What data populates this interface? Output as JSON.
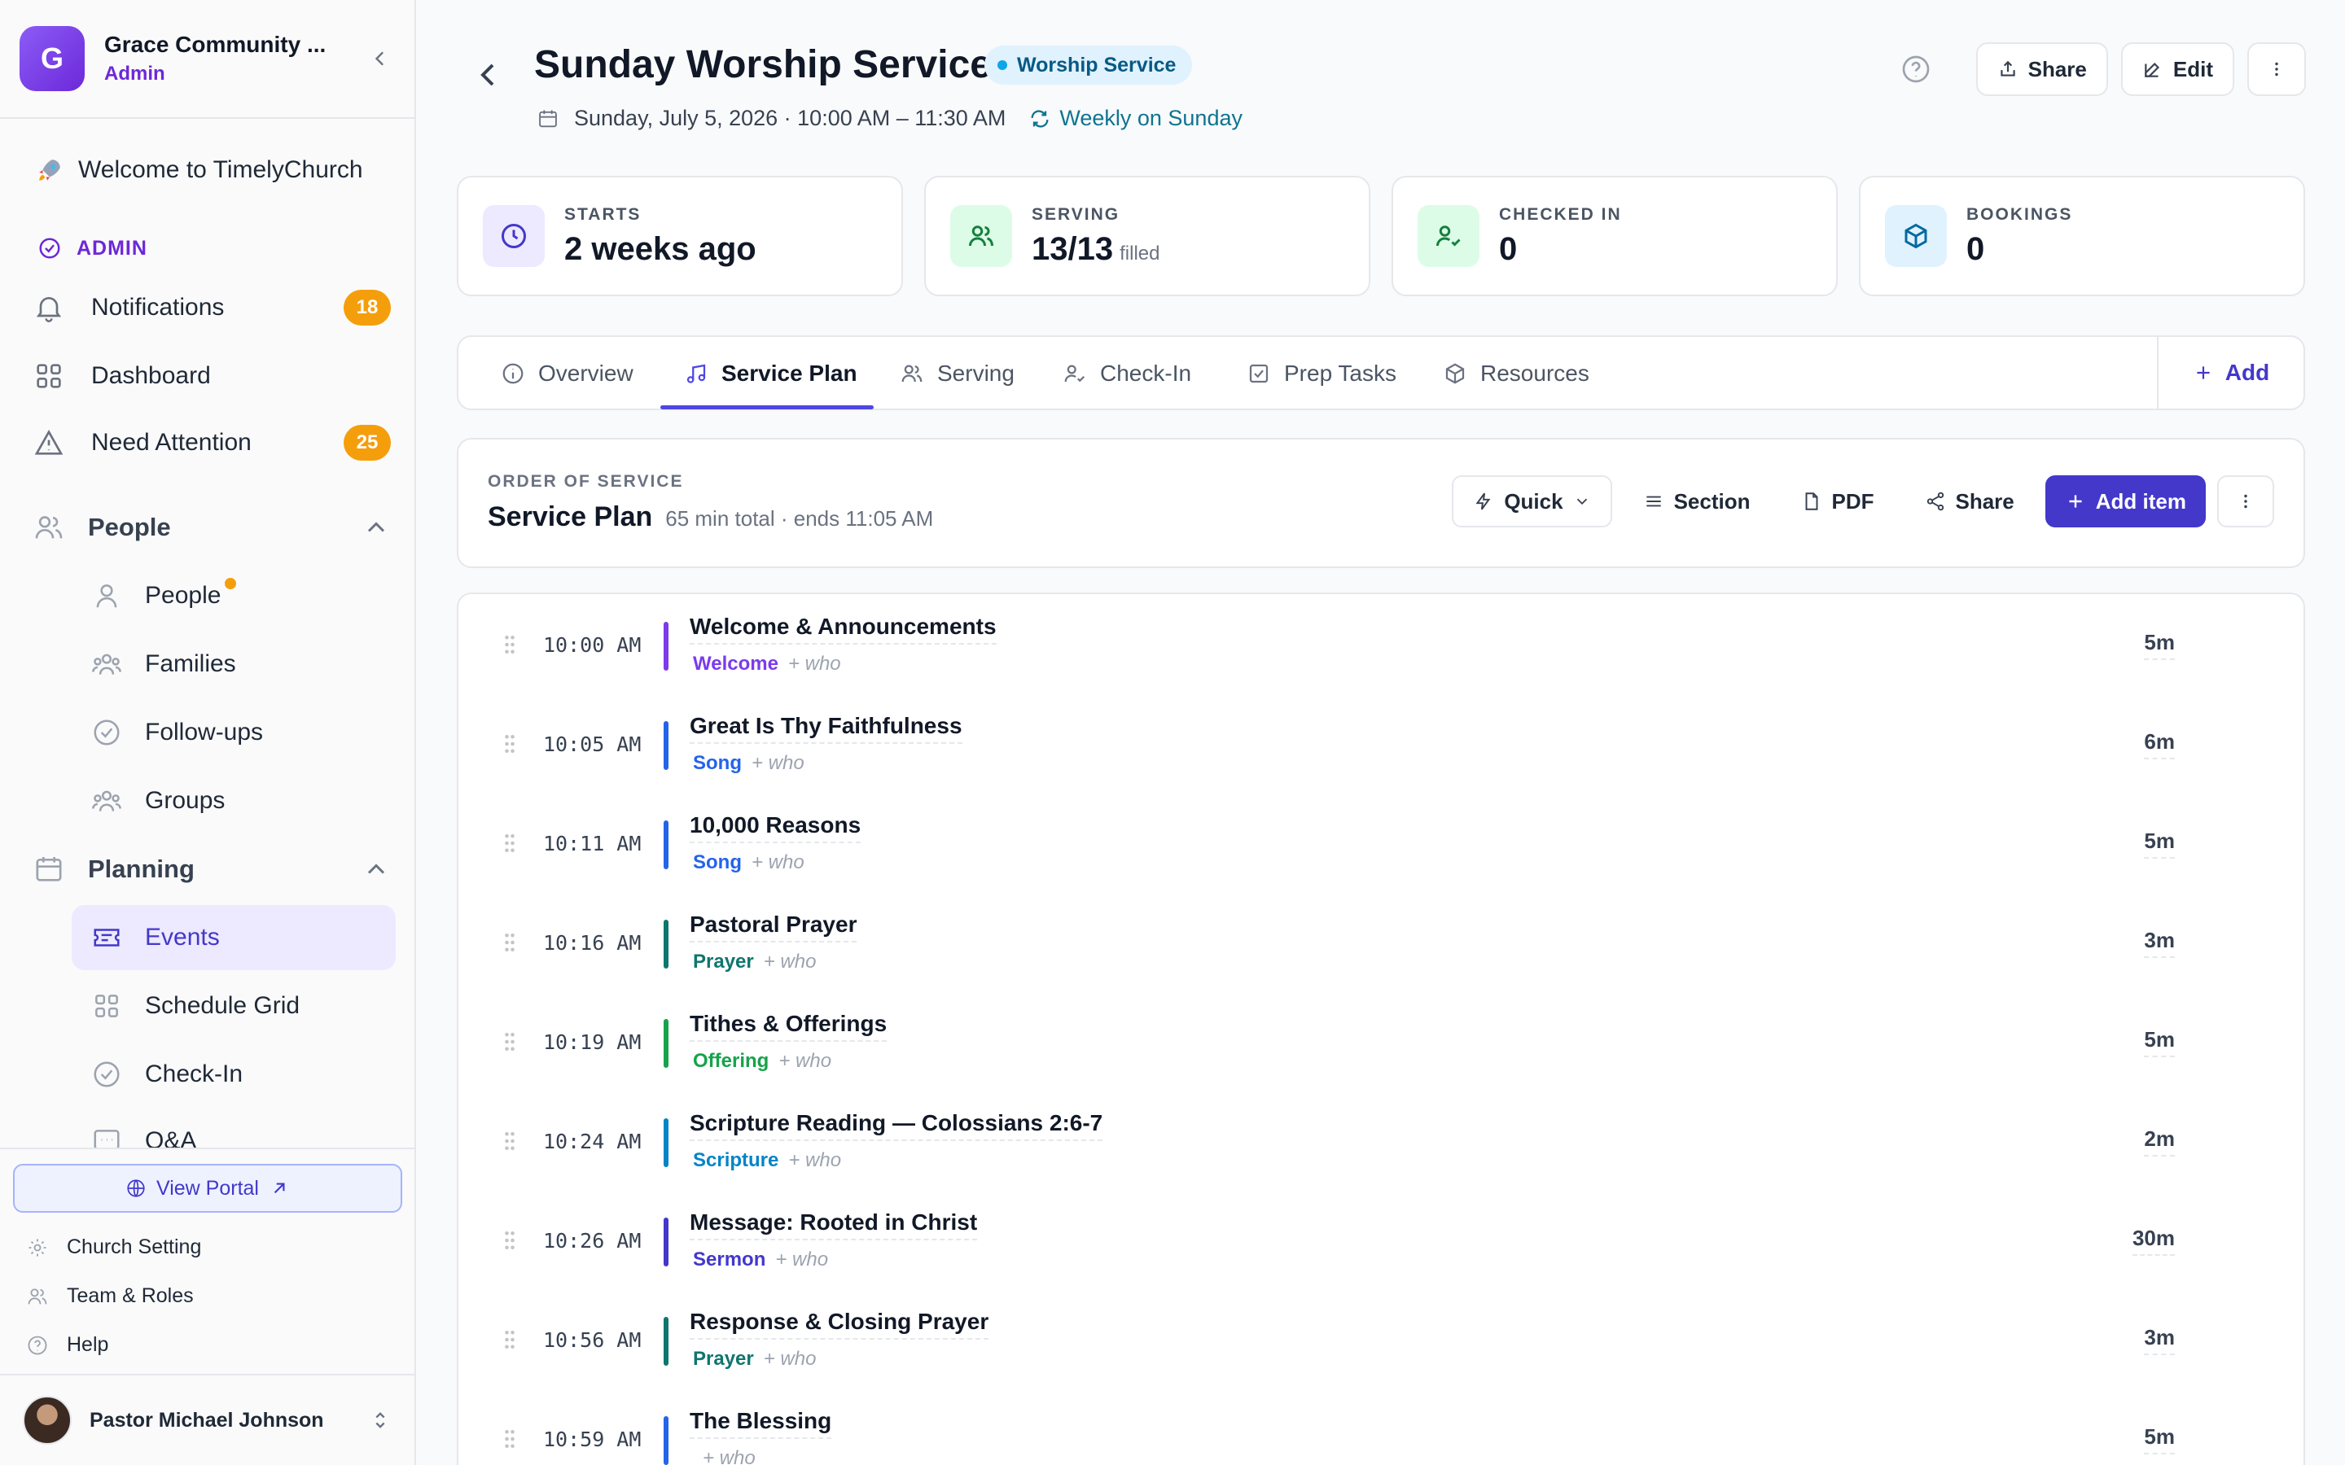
{
  "org": {
    "initial": "G",
    "name": "Grace Community ...",
    "role": "Admin"
  },
  "sidebar": {
    "welcome": "Welcome to TimelyChurch",
    "admin_label": "ADMIN",
    "notifications": {
      "label": "Notifications",
      "badge": "18"
    },
    "dashboard": "Dashboard",
    "need_attention": {
      "label": "Need Attention",
      "badge": "25"
    },
    "people_group": "People",
    "people_items": [
      "People",
      "Families",
      "Follow-ups",
      "Groups"
    ],
    "planning_group": "Planning",
    "planning_items": [
      "Events",
      "Schedule Grid",
      "Check-In",
      "Q&A"
    ],
    "view_portal": "View Portal",
    "church_setting": "Church Setting",
    "team_roles": "Team & Roles",
    "help": "Help",
    "user_name": "Pastor Michael Johnson"
  },
  "header": {
    "title": "Sunday Worship Service",
    "tag": "Worship Service",
    "datetime": "Sunday, July 5, 2026 · 10:00 AM – 11:30 AM",
    "recurrence": "Weekly on Sunday",
    "share": "Share",
    "edit": "Edit"
  },
  "stats": [
    {
      "label": "STARTS",
      "value": "2 weeks ago",
      "suffix": ""
    },
    {
      "label": "SERVING",
      "value": "13/13",
      "suffix": "filled"
    },
    {
      "label": "CHECKED IN",
      "value": "0",
      "suffix": ""
    },
    {
      "label": "BOOKINGS",
      "value": "0",
      "suffix": ""
    }
  ],
  "tabs": [
    "Overview",
    "Service Plan",
    "Serving",
    "Check-In",
    "Prep Tasks",
    "Resources"
  ],
  "tab_add": "Add",
  "plan": {
    "label": "ORDER OF SERVICE",
    "title": "Service Plan",
    "summary": "65 min total · ends 11:05 AM",
    "quick": "Quick",
    "section": "Section",
    "pdf": "PDF",
    "share": "Share",
    "add_item": "Add item"
  },
  "who_placeholder": "+ who",
  "items": [
    {
      "time": "10:00 AM",
      "name": "Welcome & Announcements",
      "category": "Welcome",
      "duration": "5m",
      "color": "#7c3aed"
    },
    {
      "time": "10:05 AM",
      "name": "Great Is Thy Faithfulness",
      "category": "Song",
      "duration": "6m",
      "color": "#2563eb"
    },
    {
      "time": "10:11 AM",
      "name": "10,000 Reasons",
      "category": "Song",
      "duration": "5m",
      "color": "#2563eb"
    },
    {
      "time": "10:16 AM",
      "name": "Pastoral Prayer",
      "category": "Prayer",
      "duration": "3m",
      "color": "#0f766e"
    },
    {
      "time": "10:19 AM",
      "name": "Tithes & Offerings",
      "category": "Offering",
      "duration": "5m",
      "color": "#16a34a"
    },
    {
      "time": "10:24 AM",
      "name": "Scripture Reading — Colossians 2:6-7",
      "category": "Scripture",
      "duration": "2m",
      "color": "#0284c7"
    },
    {
      "time": "10:26 AM",
      "name": "Message: Rooted in Christ",
      "category": "Sermon",
      "duration": "30m",
      "color": "#4338ca"
    },
    {
      "time": "10:56 AM",
      "name": "Response & Closing Prayer",
      "category": "Prayer",
      "duration": "3m",
      "color": "#0f766e"
    },
    {
      "time": "10:59 AM",
      "name": "The Blessing",
      "category": "",
      "duration": "5m",
      "color": "#2563eb"
    }
  ]
}
